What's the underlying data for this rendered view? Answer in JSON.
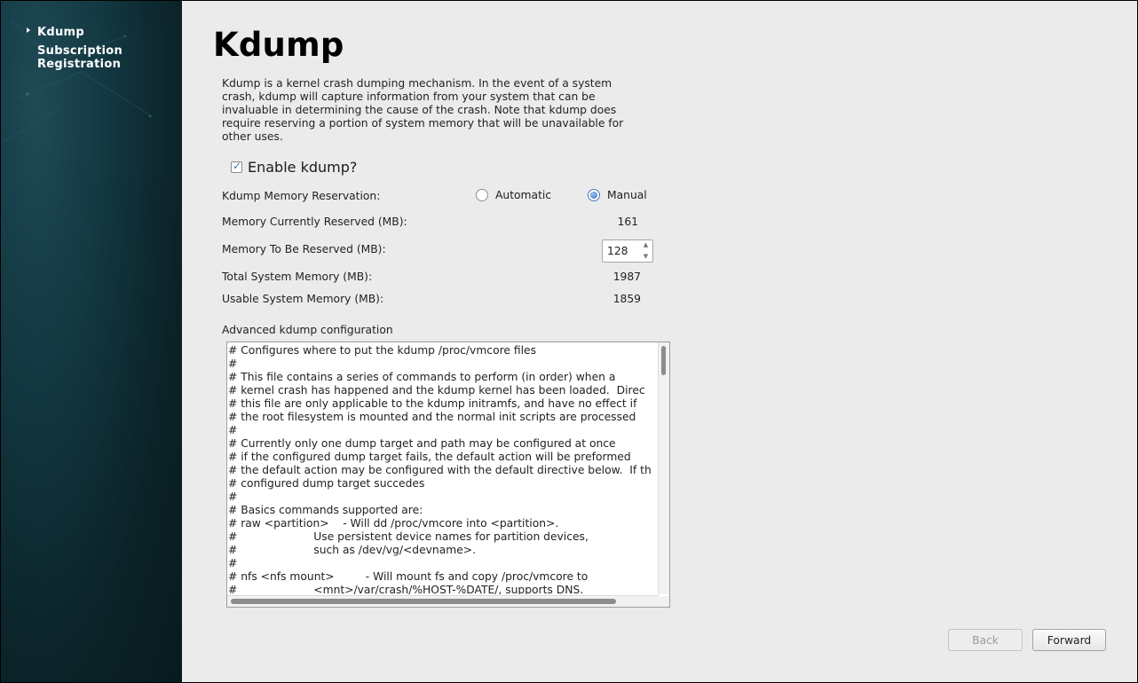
{
  "sidebar": {
    "items": [
      {
        "label": "Kdump",
        "active": true
      },
      {
        "label": "Subscription",
        "label2": "Registration",
        "active": false
      }
    ]
  },
  "page": {
    "title": "Kdump",
    "description": "Kdump is a kernel crash dumping mechanism. In the event of a system crash, kdump will capture information from your system that can be invaluable in determining the cause of the crash. Note that kdump does require reserving a portion of system memory that will be unavailable for other uses."
  },
  "enable": {
    "label": "Enable kdump?",
    "checked": true
  },
  "reservation": {
    "label": "Kdump Memory Reservation:",
    "options": [
      {
        "label": "Automatic",
        "selected": false
      },
      {
        "label": "Manual",
        "selected": true
      }
    ]
  },
  "memory": {
    "current_label": "Memory Currently Reserved (MB):",
    "current_value": "161",
    "to_reserve_label": "Memory To Be Reserved (MB):",
    "to_reserve_value": "128",
    "total_label": "Total System Memory (MB):",
    "total_value": "1987",
    "usable_label": "Usable System Memory (MB):",
    "usable_value": "1859"
  },
  "advanced": {
    "label": "Advanced kdump configuration",
    "lines": [
      "# Configures where to put the kdump /proc/vmcore files",
      "#",
      "# This file contains a series of commands to perform (in order) when a",
      "# kernel crash has happened and the kdump kernel has been loaded.  Direc",
      "# this file are only applicable to the kdump initramfs, and have no effect if",
      "# the root filesystem is mounted and the normal init scripts are processed",
      "#",
      "# Currently only one dump target and path may be configured at once",
      "# if the configured dump target fails, the default action will be preformed",
      "# the default action may be configured with the default directive below.  If th",
      "# configured dump target succedes",
      "#",
      "# Basics commands supported are:",
      "# raw <partition>    - Will dd /proc/vmcore into <partition>.",
      "#                      Use persistent device names for partition devices,",
      "#                      such as /dev/vg/<devname>.",
      "#",
      "# nfs <nfs mount>         - Will mount fs and copy /proc/vmcore to",
      "#                      <mnt>/var/crash/%HOST-%DATE/, supports DNS."
    ]
  },
  "buttons": {
    "back": "Back",
    "forward": "Forward"
  },
  "colors": {
    "sidebar": "#0b2228",
    "background": "#ebebeb",
    "accent": "#3b71c2"
  }
}
